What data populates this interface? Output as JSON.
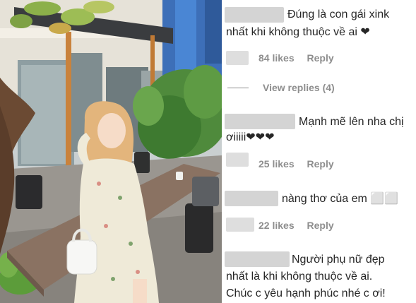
{
  "comments": [
    {
      "line1": "Đúng là con gái xink",
      "line2": "nhất khi không thuộc về ai ❤",
      "likes": "84 likes",
      "reply": "Reply",
      "view_replies": "View replies (4)"
    },
    {
      "line1": "Mạnh mẽ lên nha chị",
      "line2": "ơiiiii❤❤❤",
      "likes": "25 likes",
      "reply": "Reply"
    },
    {
      "line1": "nàng thơ của em ⬜⬜",
      "likes": "22 likes",
      "reply": "Reply"
    },
    {
      "line1": "Người phụ nữ đẹp",
      "line2": "nhất là khi không thuộc về ai.",
      "line3": "Chúc c yêu hạnh phúc nhé c ơi!"
    }
  ],
  "colors": {
    "text": "#262626",
    "meta": "#8e8e8e",
    "redacted": "#d4d4d4"
  }
}
